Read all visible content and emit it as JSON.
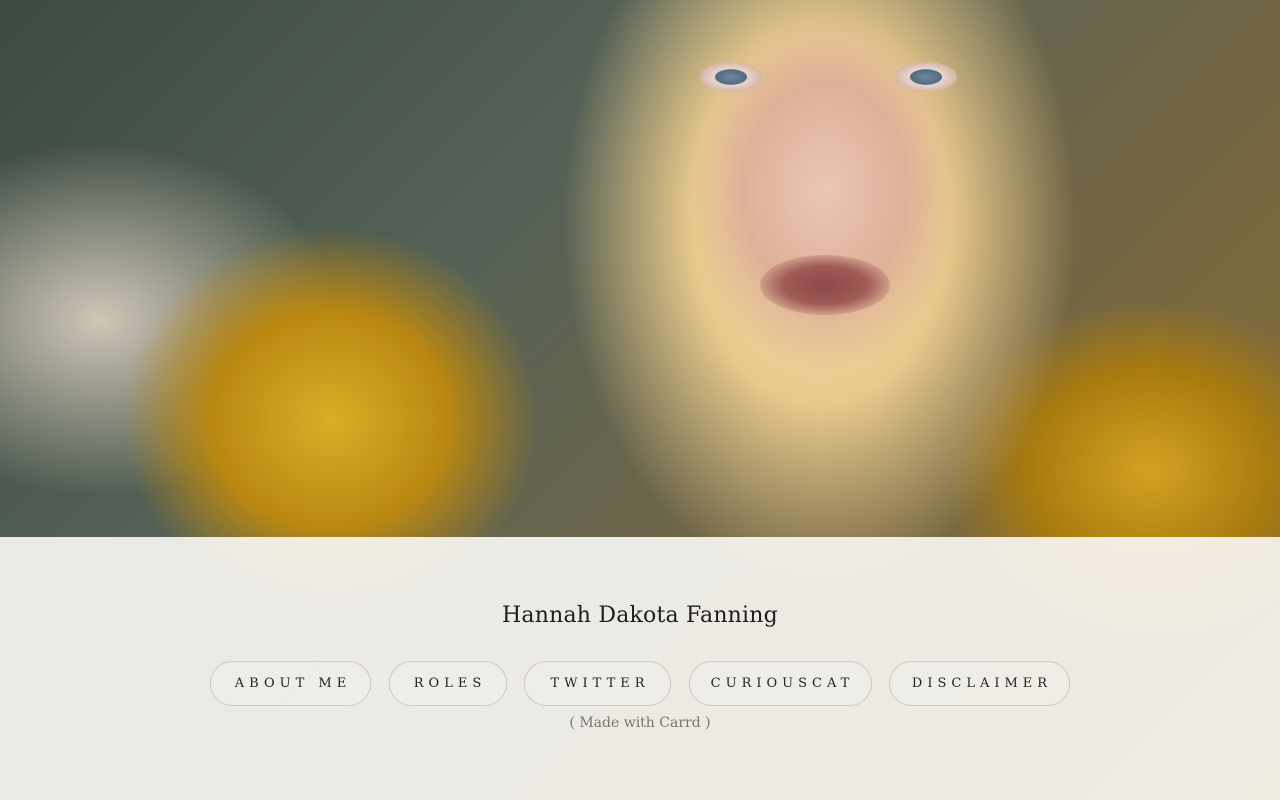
{
  "hero": {
    "image_icon": "portrait-photo"
  },
  "header": {
    "title": "Hannah Dakota Fanning"
  },
  "nav": {
    "items": [
      {
        "label": "ABOUT ME"
      },
      {
        "label": "ROLES"
      },
      {
        "label": "TWITTER"
      },
      {
        "label": "CURIOUSCAT"
      },
      {
        "label": "DISCLAIMER"
      }
    ]
  },
  "footer": {
    "credit_open": "( ",
    "credit_link": "Made with Carrd",
    "credit_close": " )"
  },
  "colors": {
    "panel": "#faf8f5",
    "text": "#1d1d1d",
    "button_border": "#cfcac3",
    "muted": "#7a7570"
  }
}
